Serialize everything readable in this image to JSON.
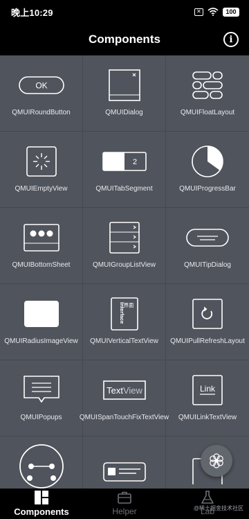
{
  "status_bar": {
    "time": "晚上10:29",
    "battery": "100"
  },
  "top_bar": {
    "title": "Components",
    "info_icon": "info-icon"
  },
  "components": [
    {
      "label": "QMUIRoundButton",
      "icon": "round-button-icon",
      "button_text": "OK"
    },
    {
      "label": "QMUIDialog",
      "icon": "dialog-icon"
    },
    {
      "label": "QMUIFloatLayout",
      "icon": "float-layout-icon"
    },
    {
      "label": "QMUIEmptyView",
      "icon": "empty-view-icon"
    },
    {
      "label": "QMUITabSegment",
      "icon": "tab-segment-icon",
      "tab_number": "2"
    },
    {
      "label": "QMUIProgressBar",
      "icon": "progress-bar-icon"
    },
    {
      "label": "QMUIBottomSheet",
      "icon": "bottom-sheet-icon"
    },
    {
      "label": "QMUIGroupListView",
      "icon": "group-list-icon"
    },
    {
      "label": "QMUITipDialog",
      "icon": "tip-dialog-icon"
    },
    {
      "label": "QMUIRadiusImageView",
      "icon": "radius-image-icon"
    },
    {
      "label": "QMUIVerticalTextView",
      "icon": "vertical-text-icon",
      "text_cn": "界面",
      "text_en": "Interface"
    },
    {
      "label": "QMUIPullRefreshLayout",
      "icon": "pull-refresh-icon"
    },
    {
      "label": "QMUIPopups",
      "icon": "popups-icon"
    },
    {
      "label": "QMUISpanTouchFixTextView",
      "icon": "span-touch-icon",
      "text_a": "Text",
      "text_b": "View"
    },
    {
      "label": "QMUILinkTextView",
      "icon": "link-text-icon",
      "link_text": "Link"
    },
    {
      "label": "",
      "icon": "slider-icon"
    },
    {
      "label": "",
      "icon": "id-card-icon"
    },
    {
      "label": "",
      "icon": "partial-box-icon"
    }
  ],
  "tabs": [
    {
      "label": "Components",
      "icon": "components-tab-icon",
      "active": true
    },
    {
      "label": "Helper",
      "icon": "helper-briefcase-icon",
      "active": false
    },
    {
      "label": "Lab",
      "icon": "lab-flask-icon",
      "active": false
    }
  ],
  "watermark": "@稀土掘金技术社区",
  "colors": {
    "grid_bg": "#50545c",
    "bar_bg": "#000000",
    "text": "#ffffff",
    "inactive_tab": "#6c6f75"
  }
}
